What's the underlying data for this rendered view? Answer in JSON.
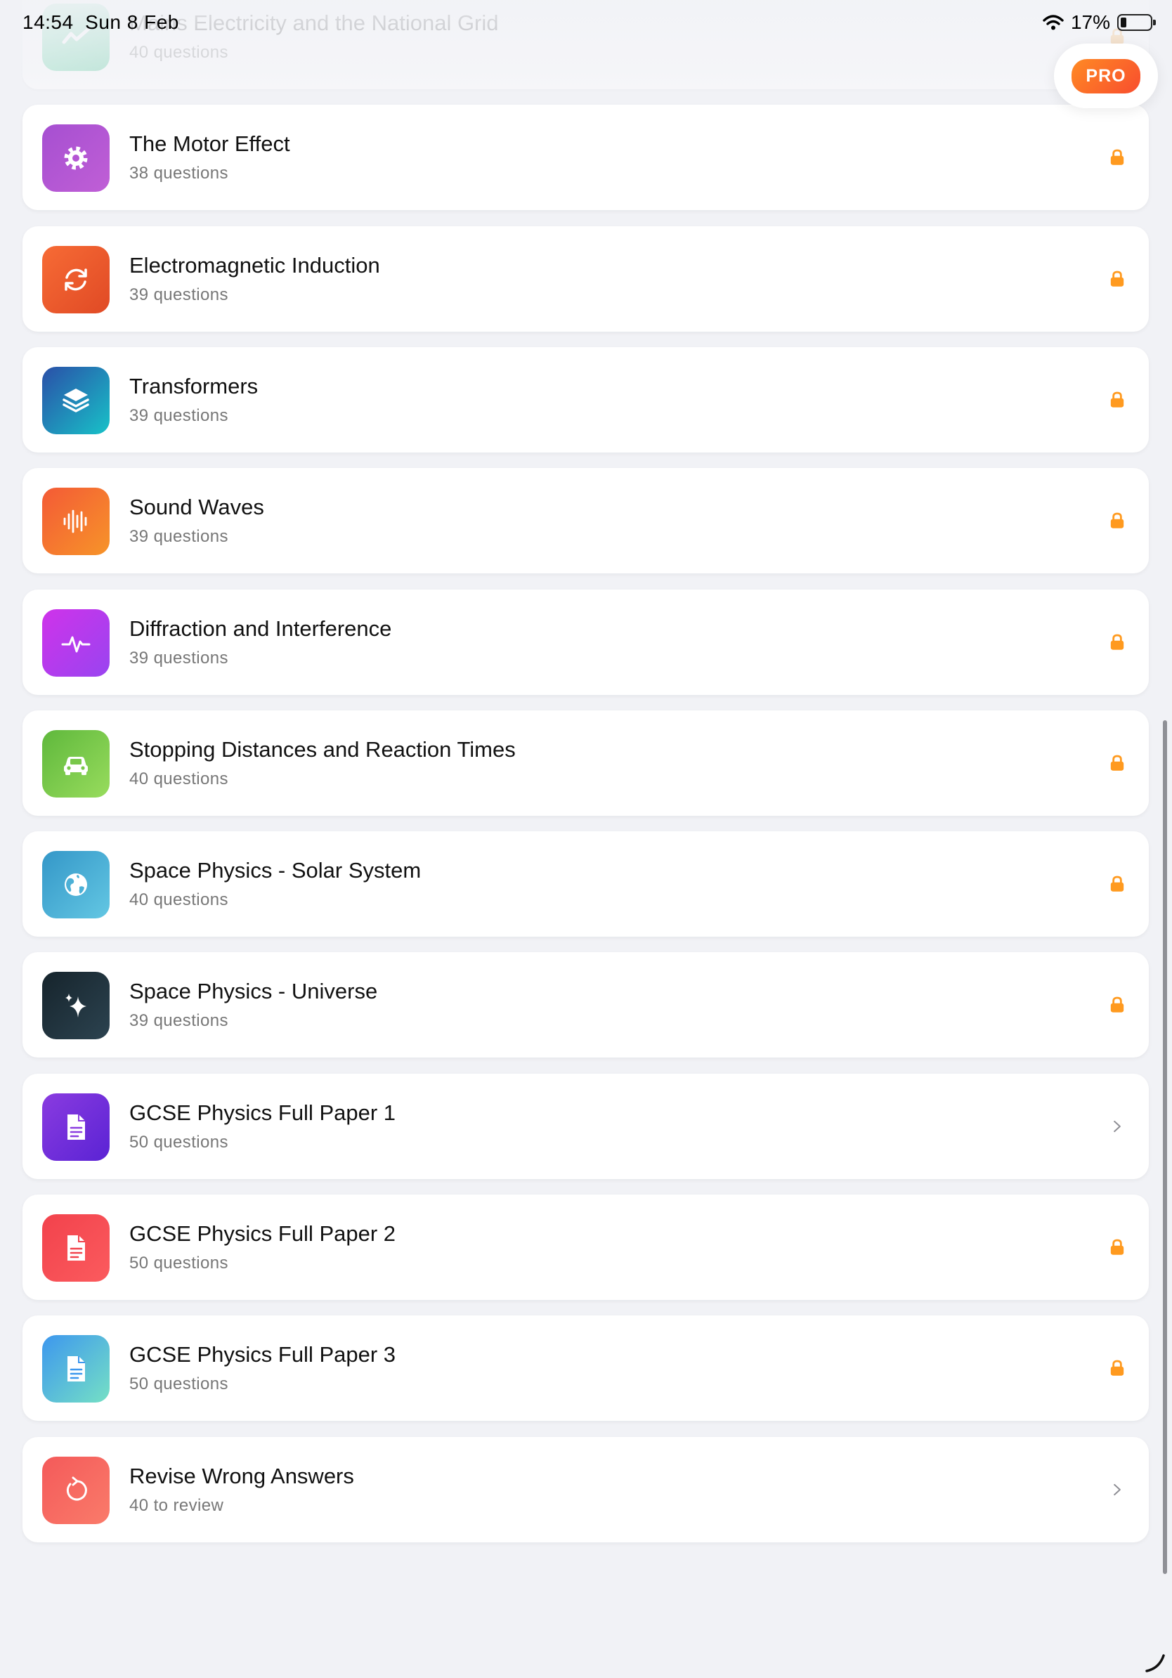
{
  "status_bar": {
    "time": "14:54",
    "date": "Sun 8 Feb",
    "battery": "17%",
    "battery_level": 0.17
  },
  "pro_badge": "PRO",
  "topics": [
    {
      "title": "Mains Electricity and the National Grid",
      "subtitle": "40 questions",
      "icon": "lightning-bolt-icon",
      "trailing": "lock-icon",
      "color_from": "#7ee0b8",
      "color_to": "#43c590",
      "faded": true
    },
    {
      "title": "The Motor Effect",
      "subtitle": "38 questions",
      "icon": "gear-icon",
      "trailing": "lock-icon",
      "color_from": "#a64fd1",
      "color_to": "#c05fd6"
    },
    {
      "title": "Electromagnetic Induction",
      "subtitle": "39 questions",
      "icon": "refresh-cycle-icon",
      "trailing": "lock-icon",
      "color_from": "#f76b35",
      "color_to": "#e04a25"
    },
    {
      "title": "Transformers",
      "subtitle": "39 questions",
      "icon": "layers-icon",
      "trailing": "lock-icon",
      "color_from": "#2a4fa8",
      "color_to": "#18c2c8"
    },
    {
      "title": "Sound Waves",
      "subtitle": "39 questions",
      "icon": "sound-wave-icon",
      "trailing": "lock-icon",
      "color_from": "#f35a36",
      "color_to": "#f79429"
    },
    {
      "title": "Diffraction and Interference",
      "subtitle": "39 questions",
      "icon": "pulse-wave-icon",
      "trailing": "lock-icon",
      "color_from": "#cf33ea",
      "color_to": "#9944f0"
    },
    {
      "title": "Stopping Distances and Reaction Times",
      "subtitle": "40 questions",
      "icon": "car-icon",
      "trailing": "lock-icon",
      "color_from": "#5fb83c",
      "color_to": "#98dc5d"
    },
    {
      "title": "Space Physics - Solar System",
      "subtitle": "40 questions",
      "icon": "globe-icon",
      "trailing": "lock-icon",
      "color_from": "#3497c8",
      "color_to": "#63c7e3"
    },
    {
      "title": "Space Physics - Universe",
      "subtitle": "39 questions",
      "icon": "sparkles-icon",
      "trailing": "lock-icon",
      "color_from": "#16242c",
      "color_to": "#2c4350"
    },
    {
      "title": "GCSE Physics Full Paper 1",
      "subtitle": "50 questions",
      "icon": "document-icon",
      "trailing": "chevron-right-icon",
      "color_from": "#8a3be0",
      "color_to": "#5a23d4"
    },
    {
      "title": "GCSE Physics Full Paper 2",
      "subtitle": "50 questions",
      "icon": "document-icon",
      "trailing": "lock-icon",
      "color_from": "#f2424c",
      "color_to": "#fb5b5e"
    },
    {
      "title": "GCSE Physics Full Paper 3",
      "subtitle": "50 questions",
      "icon": "document-icon",
      "trailing": "lock-icon",
      "color_from": "#3d97ee",
      "color_to": "#75e0c5"
    },
    {
      "title": "Revise Wrong Answers",
      "subtitle": "40 to review",
      "icon": "undo-arrow-icon",
      "trailing": "chevron-right-icon",
      "color_from": "#f45a5a",
      "color_to": "#fa7b6a"
    }
  ],
  "colors": {
    "lock": "#ff9a1f",
    "chevron": "#8d8d93",
    "background": "#f1f2f6"
  }
}
